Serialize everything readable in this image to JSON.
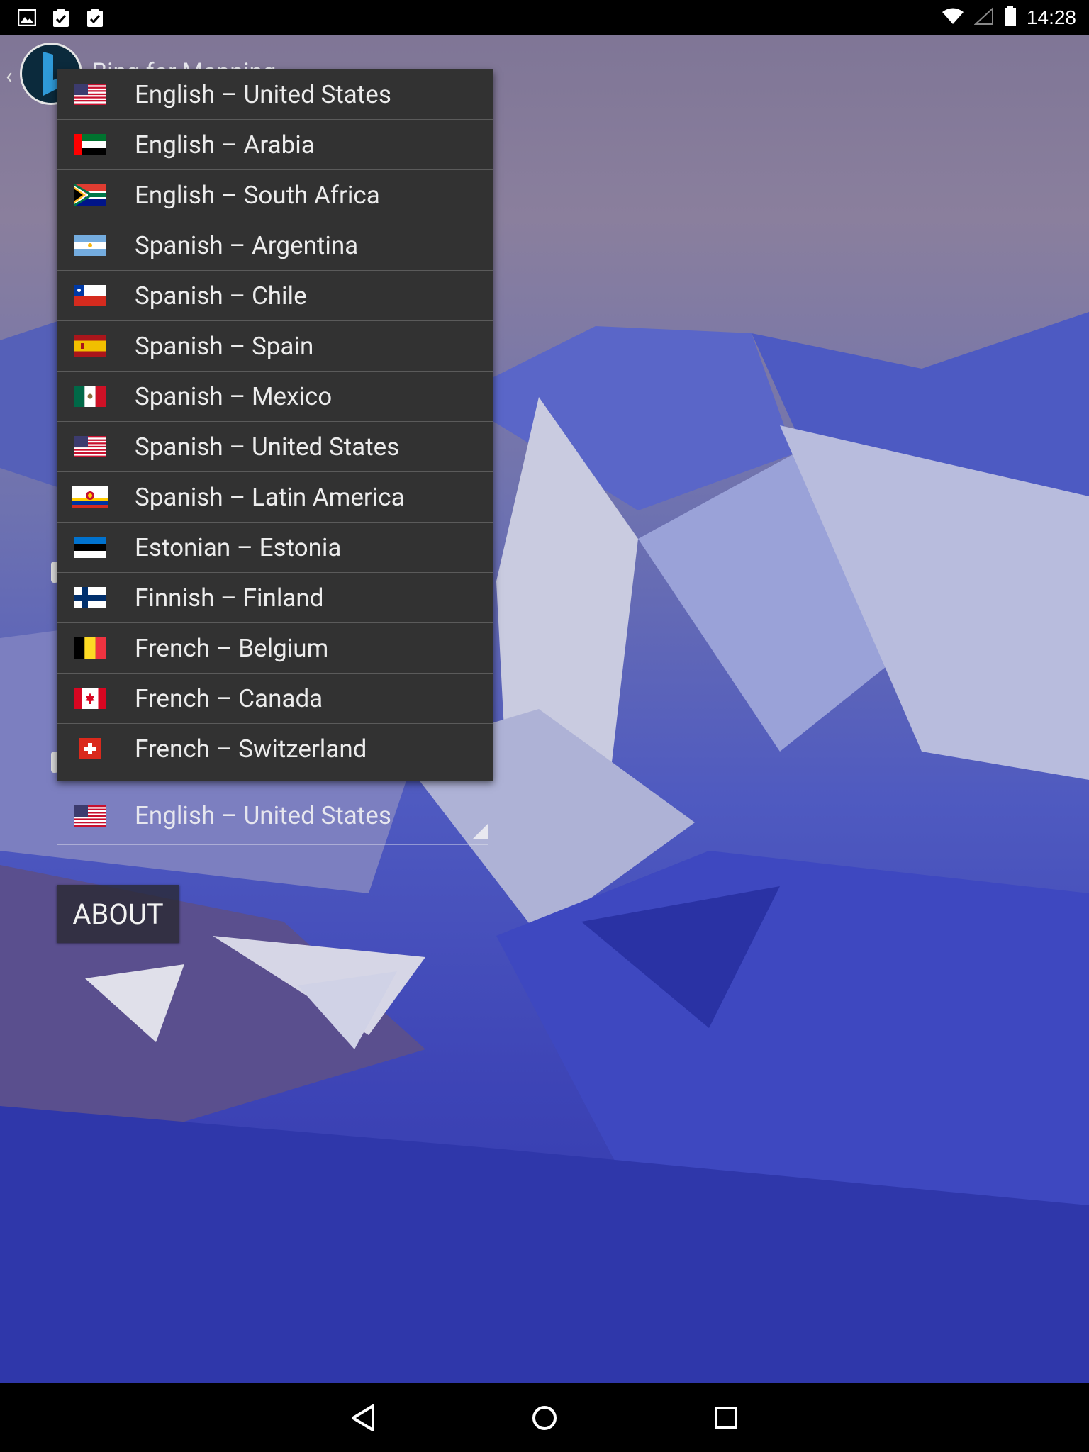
{
  "status_bar": {
    "time": "14:28",
    "left_icons": [
      "image-icon",
      "clipboard-check-icon",
      "clipboard-check-icon"
    ],
    "right_icons": [
      "wifi-icon",
      "signal-icon",
      "battery-icon"
    ]
  },
  "app": {
    "title": "Bing for Mapping"
  },
  "dropdown": {
    "items": [
      {
        "label": "English – United States",
        "flag": "us-flag-icon"
      },
      {
        "label": "English – Arabia",
        "flag": "uae-flag-icon"
      },
      {
        "label": "English – South Africa",
        "flag": "za-flag-icon"
      },
      {
        "label": "Spanish – Argentina",
        "flag": "ar-flag-icon"
      },
      {
        "label": "Spanish – Chile",
        "flag": "cl-flag-icon"
      },
      {
        "label": "Spanish – Spain",
        "flag": "es-flag-icon"
      },
      {
        "label": "Spanish – Mexico",
        "flag": "mx-flag-icon"
      },
      {
        "label": "Spanish – United States",
        "flag": "us-flag-icon"
      },
      {
        "label": "Spanish – Latin America",
        "flag": "latam-flag-icon"
      },
      {
        "label": "Estonian – Estonia",
        "flag": "ee-flag-icon"
      },
      {
        "label": "Finnish – Finland",
        "flag": "fi-flag-icon"
      },
      {
        "label": "French – Belgium",
        "flag": "be-flag-icon"
      },
      {
        "label": "French – Canada",
        "flag": "ca-flag-icon"
      },
      {
        "label": "French – Switzerland",
        "flag": "ch-flag-icon"
      }
    ]
  },
  "spinner": {
    "selected_label": "English – United States",
    "selected_flag": "us-flag-icon"
  },
  "about_button": {
    "label": "ABOUT"
  },
  "nav_bar": {
    "icons": [
      "back-icon",
      "home-icon",
      "recents-icon"
    ]
  },
  "colors": {
    "dropdown_bg": "#323232",
    "divider": "#5b5b5b",
    "status_bar": "#000000",
    "text": "#ececec"
  }
}
